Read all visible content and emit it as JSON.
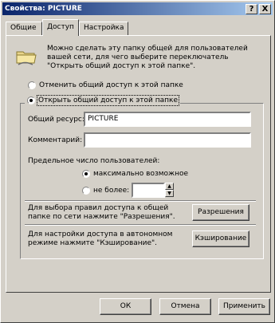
{
  "window": {
    "title": "Свойства: PICTURE",
    "help_label": "?",
    "close_label": "X"
  },
  "tabs": [
    {
      "label": "Общие"
    },
    {
      "label": "Доступ"
    },
    {
      "label": "Настройка"
    }
  ],
  "intro_text": "Можно сделать эту папку общей для пользователей вашей сети, для чего выберите переключатель \"Открыть общий доступ к этой папке\".",
  "share_options": {
    "deny_label": "Отменить общий доступ к этой папке",
    "allow_label": "Открыть общий доступ к этой папке"
  },
  "share_name": {
    "label": "Общий ресурс:",
    "value": "PICTURE"
  },
  "comment": {
    "label": "Комментарий:",
    "value": ""
  },
  "user_limit": {
    "heading": "Предельное число пользователей:",
    "max_label": "максимально возможное",
    "not_more_label": "не более:",
    "spin_value": ""
  },
  "permissions": {
    "text": "Для выбора правил доступа к общей папке по сети нажмите \"Разрешения\".",
    "button_label": "Разрешения"
  },
  "caching": {
    "text": "Для настройки доступа в автономном режиме нажмите \"Кэширование\".",
    "button_label": "Кэширование"
  },
  "footer": {
    "ok_label": "ОК",
    "cancel_label": "Отмена",
    "apply_label": "Применить"
  }
}
